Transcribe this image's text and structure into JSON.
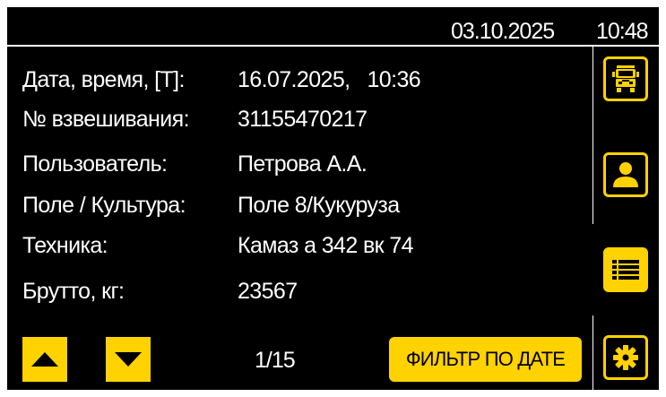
{
  "colors": {
    "accent": "#ffd200",
    "background": "#000000",
    "text": "#ffffff"
  },
  "status_bar": {
    "date": "03.10.2025",
    "time": "10:48"
  },
  "record": [
    {
      "label": "Дата, время, [Т]:",
      "value": "16.07.2025,   10:36"
    },
    {
      "label": "№ взвешивания:",
      "value": "31155470217"
    },
    {
      "label": "Пользователь:",
      "value": "Петрова А.А."
    },
    {
      "label": "Поле / Культура:",
      "value": "Поле 8/Кукуруза"
    },
    {
      "label": "Техника:",
      "value": "Камаз а 342 вк 74"
    },
    {
      "label": "Брутто, кг:",
      "value": "23567"
    }
  ],
  "pagination": {
    "indicator": "1/15"
  },
  "filter_button": {
    "label": "ФИЛЬТР ПО ДАТЕ"
  },
  "sidebar": {
    "buttons": [
      {
        "icon": "truck-icon",
        "active": false
      },
      {
        "icon": "user-icon",
        "active": false
      },
      {
        "icon": "list-icon",
        "active": true
      },
      {
        "icon": "gear-icon",
        "active": false
      }
    ]
  },
  "nav_icons": {
    "up": "triangle-up-icon",
    "down": "triangle-down-icon"
  }
}
